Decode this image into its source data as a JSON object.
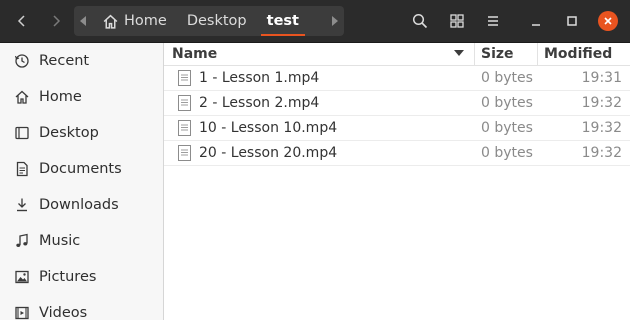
{
  "path": {
    "crumbs": [
      {
        "label": "Home",
        "icon": "home-icon"
      },
      {
        "label": "Desktop"
      },
      {
        "label": "test",
        "current": true
      }
    ]
  },
  "sidebar": {
    "items": [
      {
        "label": "Recent",
        "icon": "clock-icon"
      },
      {
        "label": "Home",
        "icon": "home-icon"
      },
      {
        "label": "Desktop",
        "icon": "desktop-icon"
      },
      {
        "label": "Documents",
        "icon": "document-icon"
      },
      {
        "label": "Downloads",
        "icon": "download-icon"
      },
      {
        "label": "Music",
        "icon": "music-icon"
      },
      {
        "label": "Pictures",
        "icon": "picture-icon"
      },
      {
        "label": "Videos",
        "icon": "video-icon"
      }
    ]
  },
  "list": {
    "columns": {
      "name": "Name",
      "size": "Size",
      "modified": "Modified"
    },
    "rows": [
      {
        "name": "1 - Lesson 1.mp4",
        "size": "0 bytes",
        "modified": "19:31"
      },
      {
        "name": "2 - Lesson 2.mp4",
        "size": "0 bytes",
        "modified": "19:32"
      },
      {
        "name": "10 - Lesson 10.mp4",
        "size": "0 bytes",
        "modified": "19:32"
      },
      {
        "name": "20 - Lesson 20.mp4",
        "size": "0 bytes",
        "modified": "19:32"
      }
    ]
  },
  "colors": {
    "accent": "#e95420",
    "headerbar": "#2b2b2b"
  }
}
